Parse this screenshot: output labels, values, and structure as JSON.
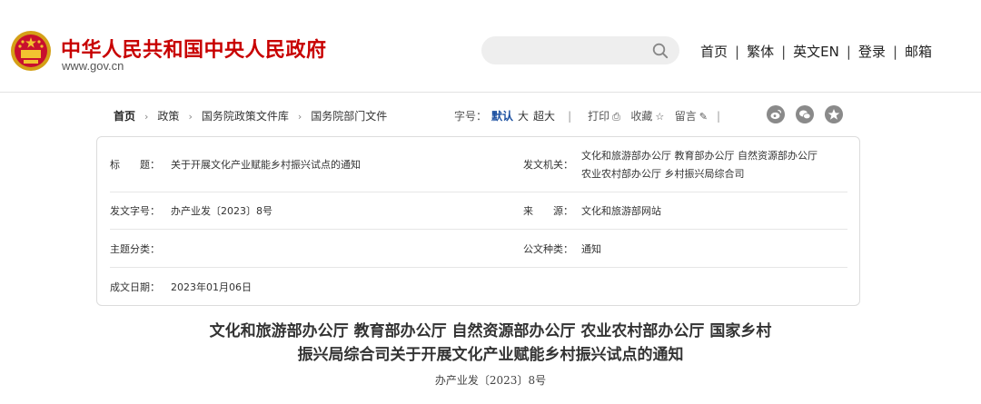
{
  "header": {
    "site_title": "中华人民共和国中央人民政府",
    "site_url": "www.gov.cn",
    "search_placeholder": "",
    "nav": [
      "首页",
      "繁体",
      "英文EN",
      "登录",
      "邮箱"
    ]
  },
  "breadcrumb": [
    "首页",
    "政策",
    "国务院政策文件库",
    "国务院部门文件"
  ],
  "tools": {
    "font_size_label": "字号：",
    "font_sizes": [
      "默认",
      "大",
      "超大"
    ],
    "print_label": "打印",
    "favorite_label": "收藏",
    "comment_label": "留言"
  },
  "info": {
    "title_label": "标　　题：",
    "title_value": "关于开展文化产业赋能乡村振兴试点的通知",
    "issuer_label": "发文机关：",
    "issuer_line1": "文化和旅游部办公厅  教育部办公厅  自然资源部办公厅",
    "issuer_line2": "农业农村部办公厅  乡村振兴局综合司",
    "docnum_label": "发文字号：",
    "docnum_value": "办产业发〔2023〕8号",
    "source_label": "来　　源：",
    "source_value": "文化和旅游部网站",
    "category_label": "主题分类：",
    "category_value": "",
    "type_label": "公文种类：",
    "type_value": "通知",
    "date_label": "成文日期：",
    "date_value": "2023年01月06日"
  },
  "document": {
    "title_line1": "文化和旅游部办公厅  教育部办公厅  自然资源部办公厅  农业农村部办公厅  国家乡村",
    "title_line2": "振兴局综合司关于开展文化产业赋能乡村振兴试点的通知",
    "number": "办产业发〔2023〕8号"
  },
  "colors": {
    "brand_red": "#c80000",
    "active_font_size": "#1a4fa0",
    "share_icon_gray": "#8a8a8a"
  }
}
